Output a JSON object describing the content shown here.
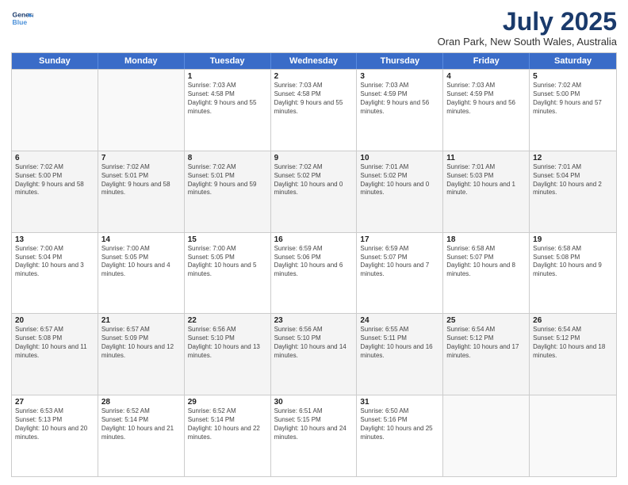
{
  "header": {
    "logo_line1": "General",
    "logo_line2": "Blue",
    "month_year": "July 2025",
    "location": "Oran Park, New South Wales, Australia"
  },
  "days_of_week": [
    "Sunday",
    "Monday",
    "Tuesday",
    "Wednesday",
    "Thursday",
    "Friday",
    "Saturday"
  ],
  "weeks": [
    [
      {
        "day": "",
        "empty": true
      },
      {
        "day": "",
        "empty": true
      },
      {
        "day": "1",
        "text": "Sunrise: 7:03 AM\nSunset: 4:58 PM\nDaylight: 9 hours and 55 minutes."
      },
      {
        "day": "2",
        "text": "Sunrise: 7:03 AM\nSunset: 4:58 PM\nDaylight: 9 hours and 55 minutes."
      },
      {
        "day": "3",
        "text": "Sunrise: 7:03 AM\nSunset: 4:59 PM\nDaylight: 9 hours and 56 minutes."
      },
      {
        "day": "4",
        "text": "Sunrise: 7:03 AM\nSunset: 4:59 PM\nDaylight: 9 hours and 56 minutes."
      },
      {
        "day": "5",
        "text": "Sunrise: 7:02 AM\nSunset: 5:00 PM\nDaylight: 9 hours and 57 minutes."
      }
    ],
    [
      {
        "day": "6",
        "text": "Sunrise: 7:02 AM\nSunset: 5:00 PM\nDaylight: 9 hours and 58 minutes."
      },
      {
        "day": "7",
        "text": "Sunrise: 7:02 AM\nSunset: 5:01 PM\nDaylight: 9 hours and 58 minutes."
      },
      {
        "day": "8",
        "text": "Sunrise: 7:02 AM\nSunset: 5:01 PM\nDaylight: 9 hours and 59 minutes."
      },
      {
        "day": "9",
        "text": "Sunrise: 7:02 AM\nSunset: 5:02 PM\nDaylight: 10 hours and 0 minutes."
      },
      {
        "day": "10",
        "text": "Sunrise: 7:01 AM\nSunset: 5:02 PM\nDaylight: 10 hours and 0 minutes."
      },
      {
        "day": "11",
        "text": "Sunrise: 7:01 AM\nSunset: 5:03 PM\nDaylight: 10 hours and 1 minute."
      },
      {
        "day": "12",
        "text": "Sunrise: 7:01 AM\nSunset: 5:04 PM\nDaylight: 10 hours and 2 minutes."
      }
    ],
    [
      {
        "day": "13",
        "text": "Sunrise: 7:00 AM\nSunset: 5:04 PM\nDaylight: 10 hours and 3 minutes."
      },
      {
        "day": "14",
        "text": "Sunrise: 7:00 AM\nSunset: 5:05 PM\nDaylight: 10 hours and 4 minutes."
      },
      {
        "day": "15",
        "text": "Sunrise: 7:00 AM\nSunset: 5:05 PM\nDaylight: 10 hours and 5 minutes."
      },
      {
        "day": "16",
        "text": "Sunrise: 6:59 AM\nSunset: 5:06 PM\nDaylight: 10 hours and 6 minutes."
      },
      {
        "day": "17",
        "text": "Sunrise: 6:59 AM\nSunset: 5:07 PM\nDaylight: 10 hours and 7 minutes."
      },
      {
        "day": "18",
        "text": "Sunrise: 6:58 AM\nSunset: 5:07 PM\nDaylight: 10 hours and 8 minutes."
      },
      {
        "day": "19",
        "text": "Sunrise: 6:58 AM\nSunset: 5:08 PM\nDaylight: 10 hours and 9 minutes."
      }
    ],
    [
      {
        "day": "20",
        "text": "Sunrise: 6:57 AM\nSunset: 5:08 PM\nDaylight: 10 hours and 11 minutes."
      },
      {
        "day": "21",
        "text": "Sunrise: 6:57 AM\nSunset: 5:09 PM\nDaylight: 10 hours and 12 minutes."
      },
      {
        "day": "22",
        "text": "Sunrise: 6:56 AM\nSunset: 5:10 PM\nDaylight: 10 hours and 13 minutes."
      },
      {
        "day": "23",
        "text": "Sunrise: 6:56 AM\nSunset: 5:10 PM\nDaylight: 10 hours and 14 minutes."
      },
      {
        "day": "24",
        "text": "Sunrise: 6:55 AM\nSunset: 5:11 PM\nDaylight: 10 hours and 16 minutes."
      },
      {
        "day": "25",
        "text": "Sunrise: 6:54 AM\nSunset: 5:12 PM\nDaylight: 10 hours and 17 minutes."
      },
      {
        "day": "26",
        "text": "Sunrise: 6:54 AM\nSunset: 5:12 PM\nDaylight: 10 hours and 18 minutes."
      }
    ],
    [
      {
        "day": "27",
        "text": "Sunrise: 6:53 AM\nSunset: 5:13 PM\nDaylight: 10 hours and 20 minutes."
      },
      {
        "day": "28",
        "text": "Sunrise: 6:52 AM\nSunset: 5:14 PM\nDaylight: 10 hours and 21 minutes."
      },
      {
        "day": "29",
        "text": "Sunrise: 6:52 AM\nSunset: 5:14 PM\nDaylight: 10 hours and 22 minutes."
      },
      {
        "day": "30",
        "text": "Sunrise: 6:51 AM\nSunset: 5:15 PM\nDaylight: 10 hours and 24 minutes."
      },
      {
        "day": "31",
        "text": "Sunrise: 6:50 AM\nSunset: 5:16 PM\nDaylight: 10 hours and 25 minutes."
      },
      {
        "day": "",
        "empty": true
      },
      {
        "day": "",
        "empty": true
      }
    ]
  ]
}
